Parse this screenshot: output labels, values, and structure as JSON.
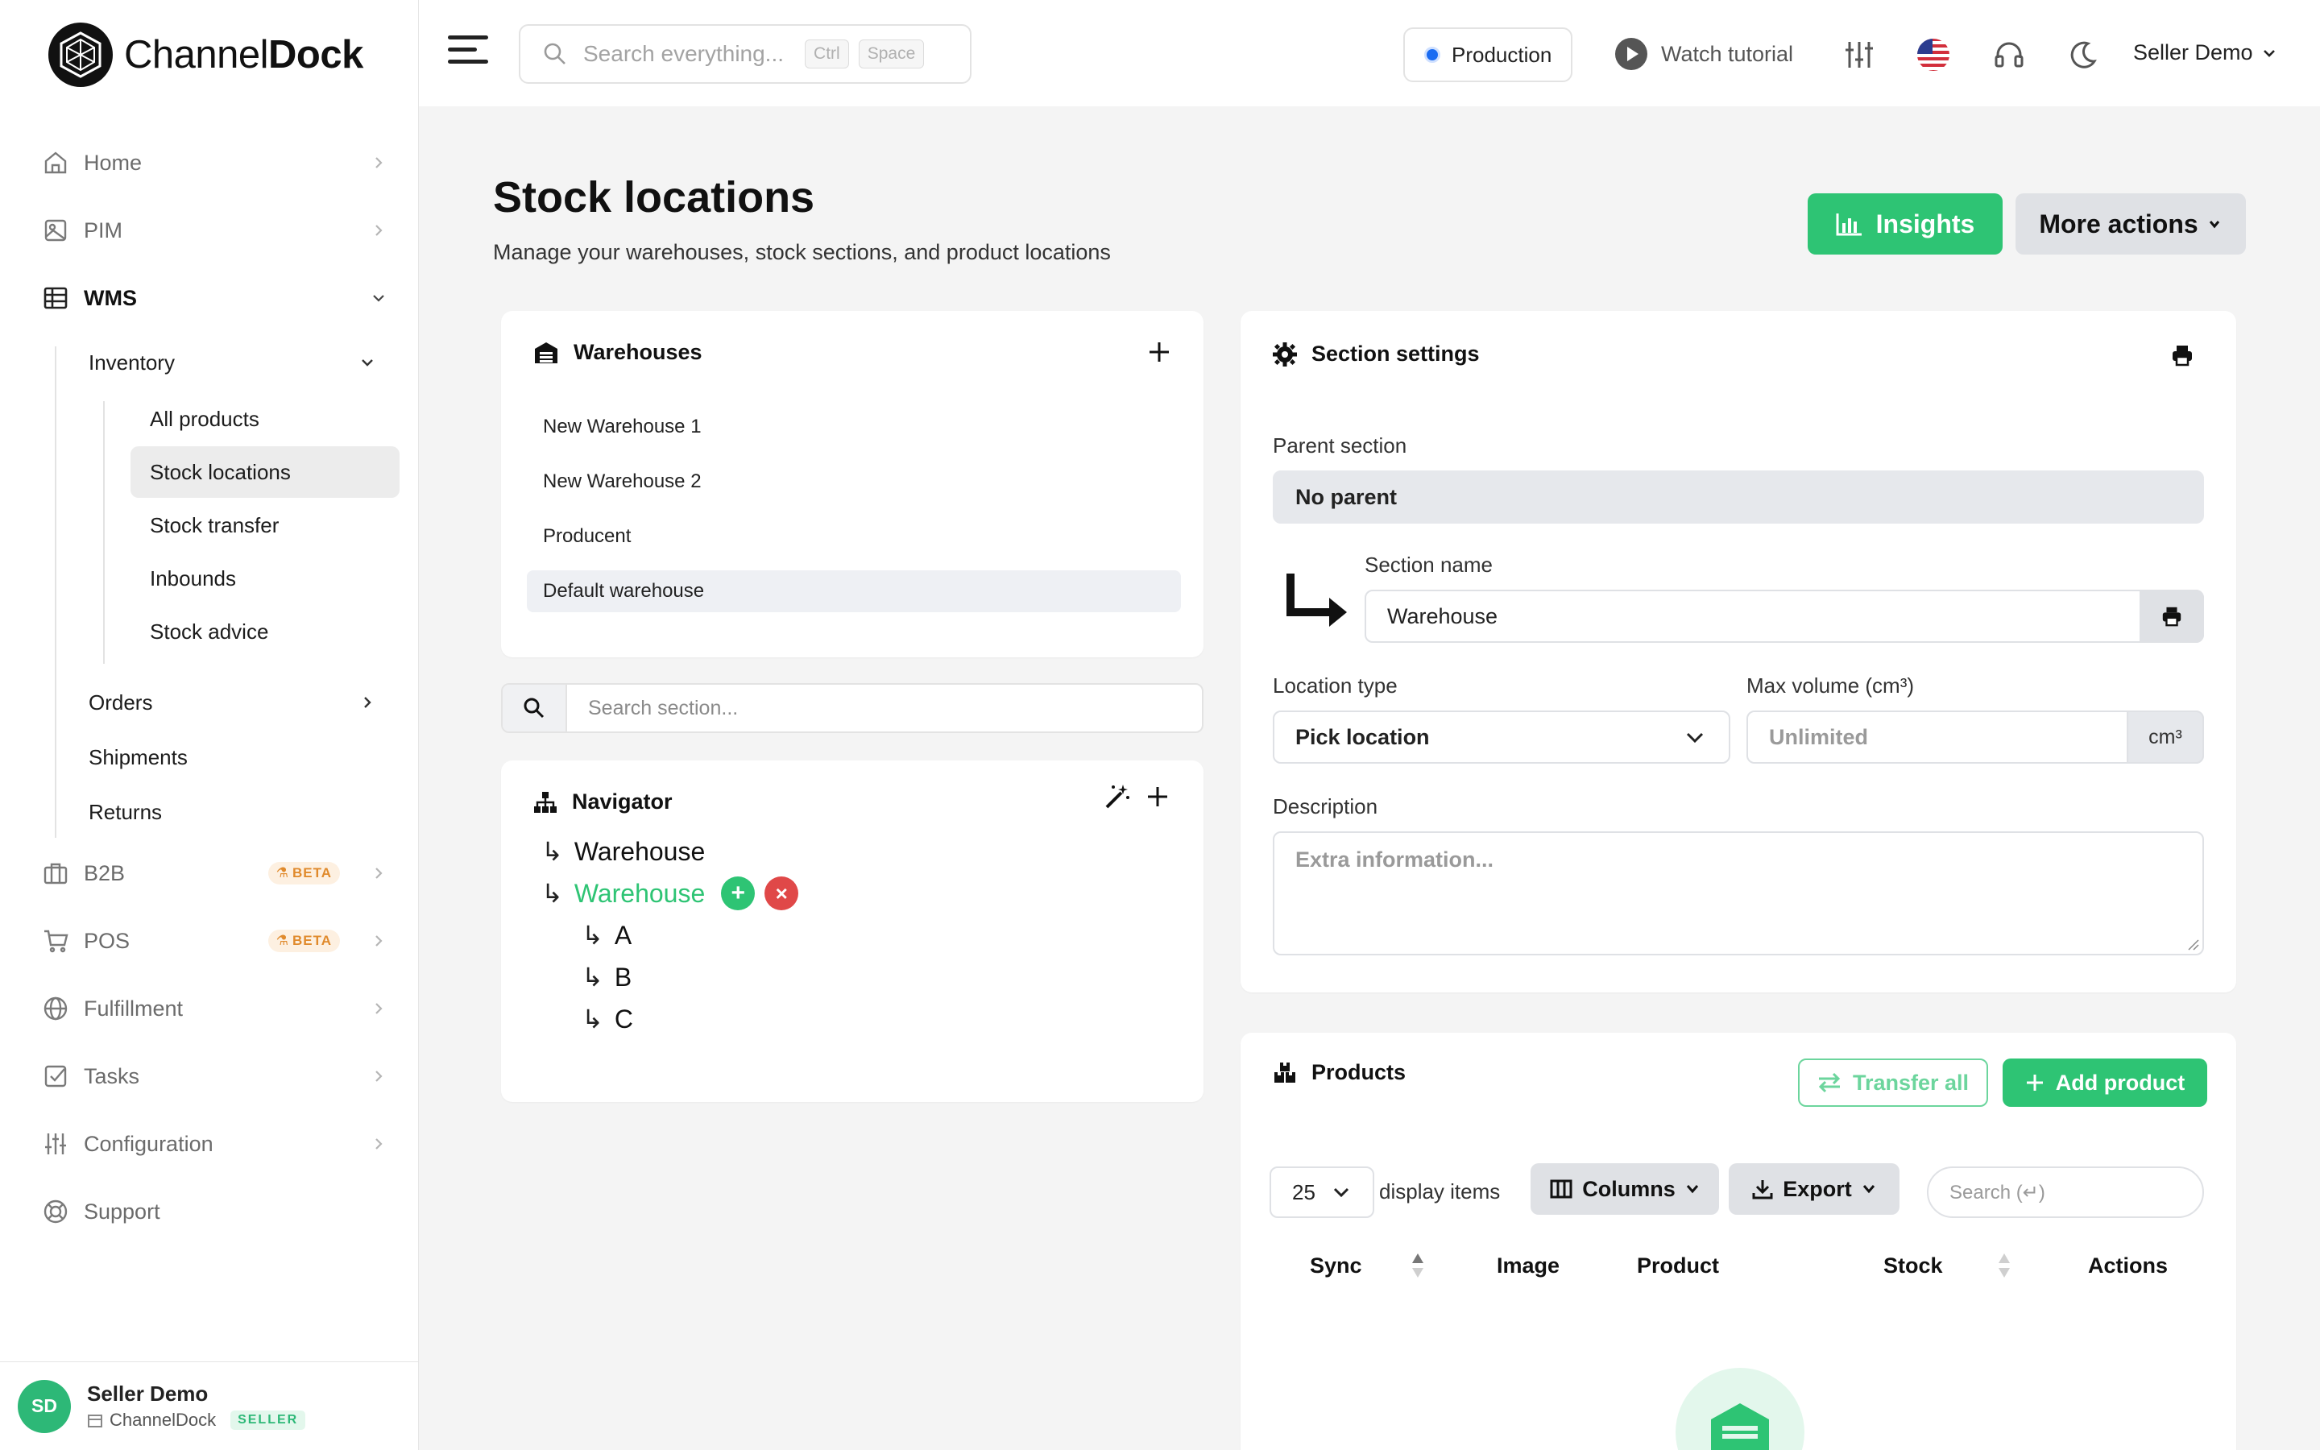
{
  "brand": {
    "name_part1": "Channel",
    "name_part2": "Dock"
  },
  "sidebar": {
    "items": [
      {
        "label": "Home"
      },
      {
        "label": "PIM"
      },
      {
        "label": "WMS"
      },
      {
        "label": "B2B",
        "badge": "BETA"
      },
      {
        "label": "POS",
        "badge": "BETA"
      },
      {
        "label": "Fulfillment"
      },
      {
        "label": "Tasks"
      },
      {
        "label": "Configuration"
      },
      {
        "label": "Support"
      }
    ],
    "wms_children": [
      {
        "label": "Inventory"
      },
      {
        "label": "Orders"
      },
      {
        "label": "Shipments"
      },
      {
        "label": "Returns"
      }
    ],
    "inventory_children": [
      {
        "label": "All products"
      },
      {
        "label": "Stock locations"
      },
      {
        "label": "Stock transfer"
      },
      {
        "label": "Inbounds"
      },
      {
        "label": "Stock advice"
      }
    ],
    "active_item": "Stock locations"
  },
  "user": {
    "initials": "SD",
    "name": "Seller Demo",
    "company": "ChannelDock",
    "role": "SELLER"
  },
  "topbar": {
    "search_placeholder": "Search everything...",
    "kbd1": "Ctrl",
    "kbd2": "Space",
    "environment": "Production",
    "tutorial": "Watch tutorial",
    "user_menu": "Seller Demo"
  },
  "page": {
    "title": "Stock locations",
    "subtitle": "Manage your warehouses, stock sections, and product locations",
    "insights_button": "Insights",
    "more_actions_button": "More actions"
  },
  "warehouses": {
    "title": "Warehouses",
    "items": [
      "New Warehouse 1",
      "New Warehouse 2",
      "Producent",
      "Default warehouse"
    ],
    "active": "Default warehouse"
  },
  "section_search": {
    "placeholder": "Search section..."
  },
  "navigator": {
    "title": "Navigator",
    "nodes": [
      {
        "label": "Warehouse",
        "level": 0
      },
      {
        "label": "Warehouse",
        "level": 0,
        "selected": true
      },
      {
        "label": "A",
        "level": 1
      },
      {
        "label": "B",
        "level": 1
      },
      {
        "label": "C",
        "level": 1
      }
    ]
  },
  "section_settings": {
    "title": "Section settings",
    "parent_label": "Parent section",
    "parent_value": "No parent",
    "name_label": "Section name",
    "name_value": "Warehouse",
    "location_type_label": "Location type",
    "location_type_value": "Pick location",
    "max_volume_label": "Max volume (cm³)",
    "max_volume_placeholder": "Unlimited",
    "max_volume_unit": "cm³",
    "description_label": "Description",
    "description_placeholder": "Extra information..."
  },
  "products": {
    "title": "Products",
    "transfer_all": "Transfer all",
    "add_product": "Add product",
    "page_size": "25",
    "display_items": "display items",
    "columns_button": "Columns",
    "export_button": "Export",
    "search_placeholder": "Search (↵)",
    "headers": [
      "Sync",
      "Image",
      "Product",
      "Stock",
      "Actions"
    ]
  },
  "colors": {
    "accent_green": "#2ec474",
    "danger_red": "#e04848",
    "env_blue": "#1a6cf2",
    "beta_orange": "#e08a2c"
  }
}
